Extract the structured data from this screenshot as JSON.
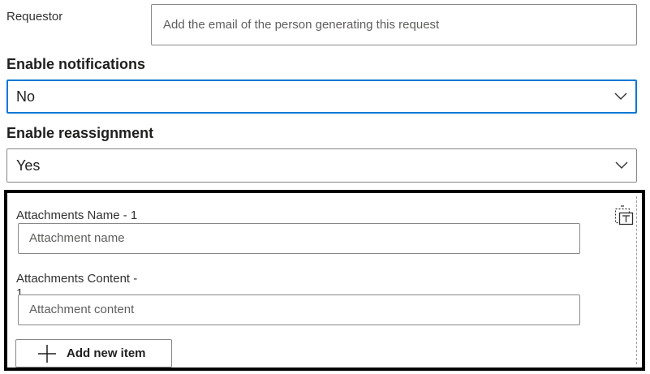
{
  "requestor": {
    "label": "Requestor",
    "placeholder": "Add the email of the person generating this request"
  },
  "notifications": {
    "title": "Enable notifications",
    "selected": "No"
  },
  "reassignment": {
    "title": "Enable reassignment",
    "selected": "Yes"
  },
  "attachments": {
    "name_label": "Attachments Name - 1",
    "name_placeholder": "Attachment name",
    "content_label": "Attachments Content -",
    "content_label_wrap": "1",
    "content_placeholder": "Attachment content",
    "add_button_label": "Add new item"
  },
  "icons": {
    "dropdown": "chevron-down-icon",
    "add": "plus-icon",
    "remove": "delete-item-icon"
  },
  "colors": {
    "focus_border": "#0078d4",
    "input_border": "#8a8886",
    "repeater_border": "#000000"
  }
}
